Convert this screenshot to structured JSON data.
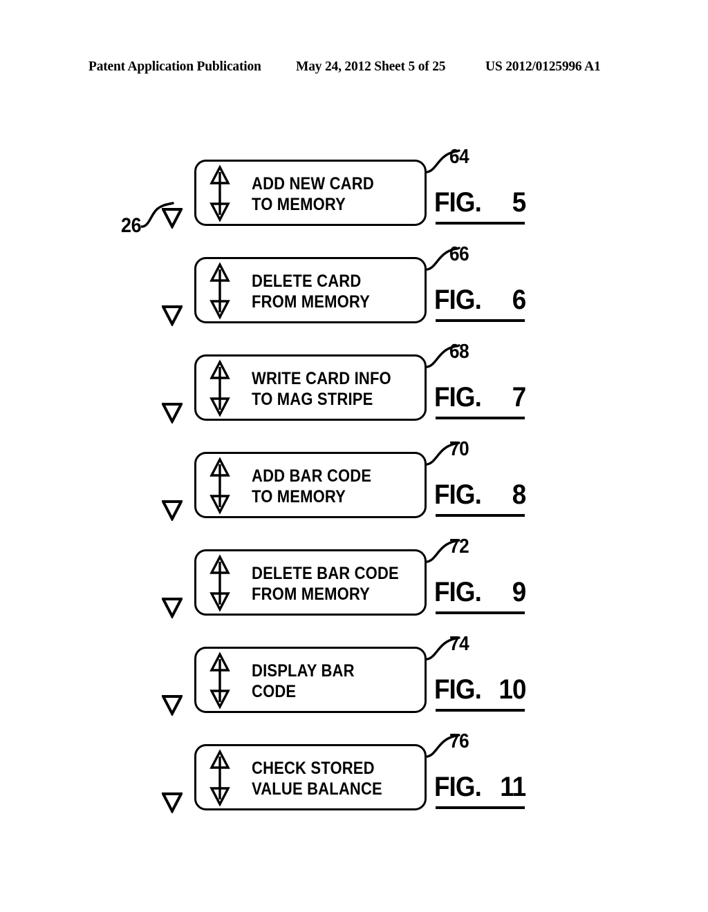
{
  "header": {
    "left": "Patent Application Publication",
    "middle": "May 24, 2012  Sheet 5 of 25",
    "right": "US 2012/0125996 A1"
  },
  "callout": {
    "label": "26",
    "icon": "down-triangle-icon"
  },
  "figure_word": "FIG.",
  "figures": [
    {
      "ref": "64",
      "fig_number": "5",
      "text": "ADD NEW CARD\nTO MEMORY",
      "line1": "ADD NEW CARD",
      "line2": "TO MEMORY"
    },
    {
      "ref": "66",
      "fig_number": "6",
      "text": "DELETE CARD\nFROM MEMORY",
      "line1": "DELETE CARD",
      "line2": "FROM MEMORY"
    },
    {
      "ref": "68",
      "fig_number": "7",
      "text": "WRITE CARD INFO\nTO MAG STRIPE",
      "line1": "WRITE CARD INFO",
      "line2": "TO MAG STRIPE"
    },
    {
      "ref": "70",
      "fig_number": "8",
      "text": "ADD BAR CODE\nTO MEMORY",
      "line1": "ADD BAR CODE",
      "line2": "TO MEMORY"
    },
    {
      "ref": "72",
      "fig_number": "9",
      "text": "DELETE BAR CODE\nFROM MEMORY",
      "line1": "DELETE BAR CODE",
      "line2": "FROM MEMORY"
    },
    {
      "ref": "74",
      "fig_number": "10",
      "text": "DISPLAY BAR\nCODE",
      "line1": "DISPLAY BAR",
      "line2": "CODE"
    },
    {
      "ref": "76",
      "fig_number": "11",
      "text": "CHECK STORED\nVALUE BALANCE",
      "line1": "CHECK STORED",
      "line2": "VALUE BALANCE"
    }
  ],
  "icons": {
    "scroll_arrow": "double-headed-vertical-arrow-icon",
    "selector": "down-triangle-icon"
  },
  "colors": {
    "ink": "#000000",
    "paper": "#ffffff"
  }
}
